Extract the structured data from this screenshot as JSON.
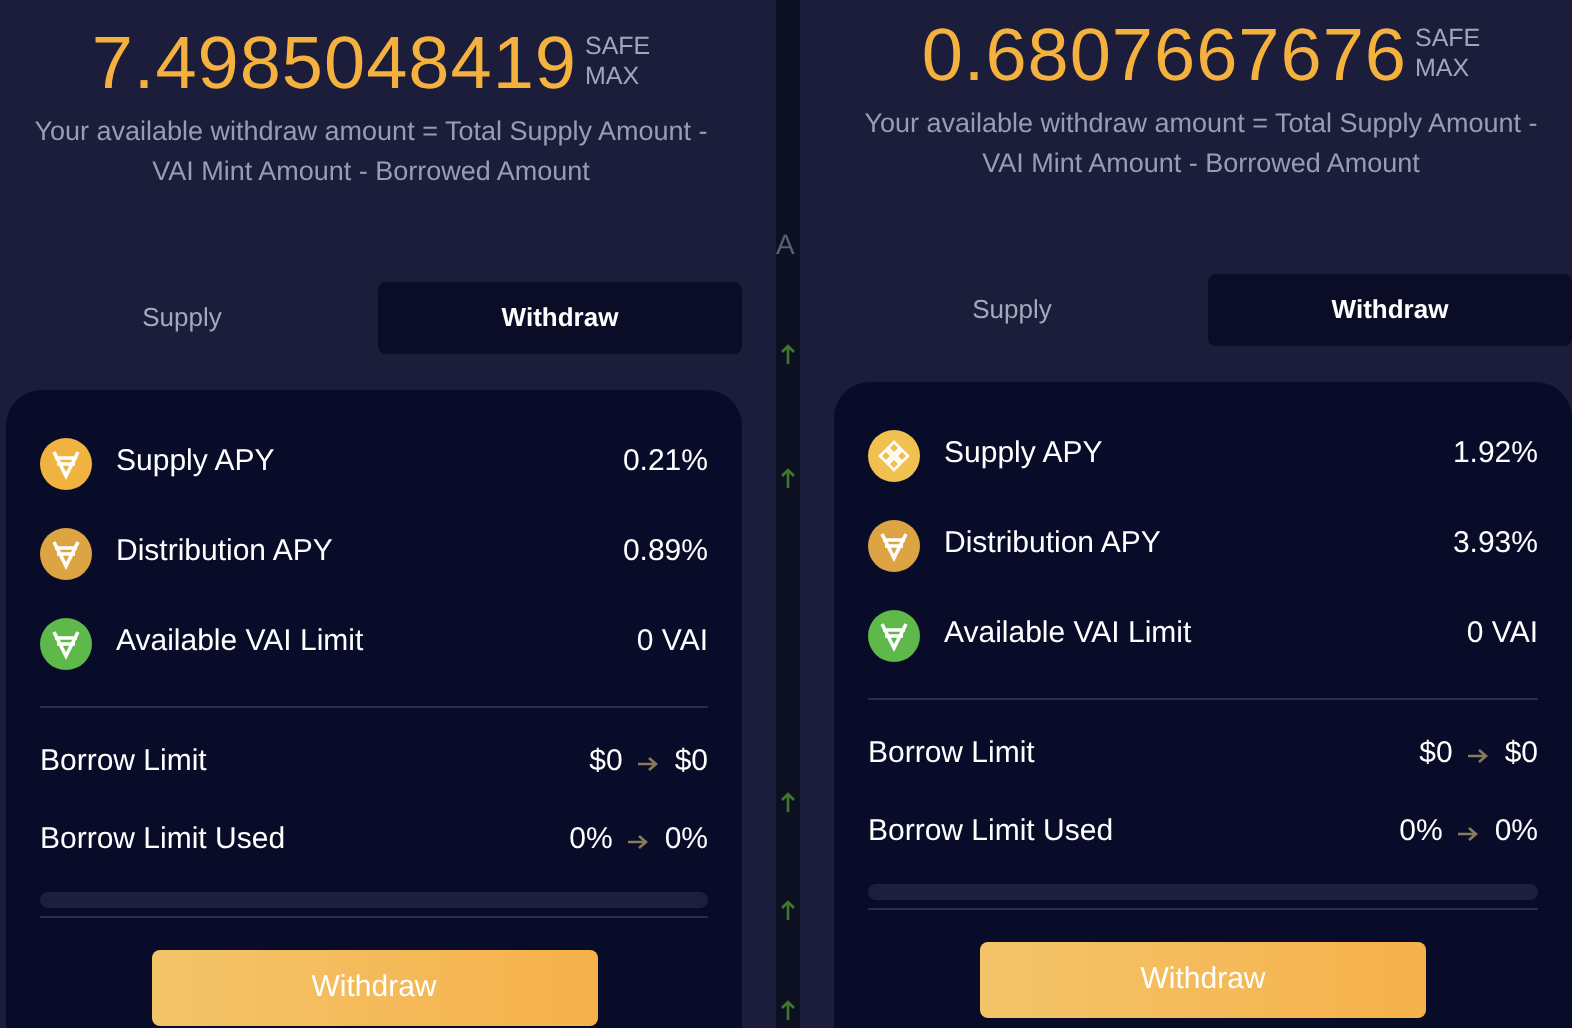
{
  "panels": [
    {
      "amount": "7.4985048419",
      "max_label_top": "SAFE",
      "max_label_bottom": "MAX",
      "note": "Your available withdraw amount = Total Supply Amount - VAI Mint Amount - Borrowed Amount",
      "tabs": [
        {
          "label": "Supply",
          "selected": false
        },
        {
          "label": "Withdraw",
          "selected": true
        }
      ],
      "stats": [
        {
          "kind": "vai",
          "color": "#f1b340",
          "label": "Supply APY",
          "value": "0.21%"
        },
        {
          "kind": "vai",
          "color": "#dca443",
          "label": "Distribution APY",
          "value": "0.89%"
        },
        {
          "kind": "vai",
          "color": "#5fb84a",
          "label": "Available VAI Limit",
          "value": "0 VAI"
        }
      ],
      "limits": [
        {
          "label": "Borrow Limit",
          "from": "$0",
          "to": "$0"
        },
        {
          "label": "Borrow Limit Used",
          "from": "0%",
          "to": "0%"
        }
      ],
      "progress": {
        "level": 0
      },
      "button": "Withdraw"
    },
    {
      "amount": "0.6807667676",
      "max_label_top": "SAFE",
      "max_label_bottom": "MAX",
      "note": "Your available withdraw amount = Total Supply Amount - VAI Mint Amount - Borrowed Amount",
      "tabs": [
        {
          "label": "Supply",
          "selected": false
        },
        {
          "label": "Withdraw",
          "selected": true
        }
      ],
      "stats": [
        {
          "kind": "bnb",
          "color": "#f0c050",
          "label": "Supply APY",
          "value": "1.92%"
        },
        {
          "kind": "vai",
          "color": "#dca443",
          "label": "Distribution APY",
          "value": "3.93%"
        },
        {
          "kind": "vai",
          "color": "#5fb84a",
          "label": "Available VAI Limit",
          "value": "0 VAI"
        }
      ],
      "limits": [
        {
          "label": "Borrow Limit",
          "from": "$0",
          "to": "$0"
        },
        {
          "label": "Borrow Limit Used",
          "from": "0%",
          "to": "0%"
        }
      ],
      "progress": {
        "level": 0
      },
      "button": "Withdraw"
    }
  ],
  "divider_strip": {
    "letter": "A"
  }
}
